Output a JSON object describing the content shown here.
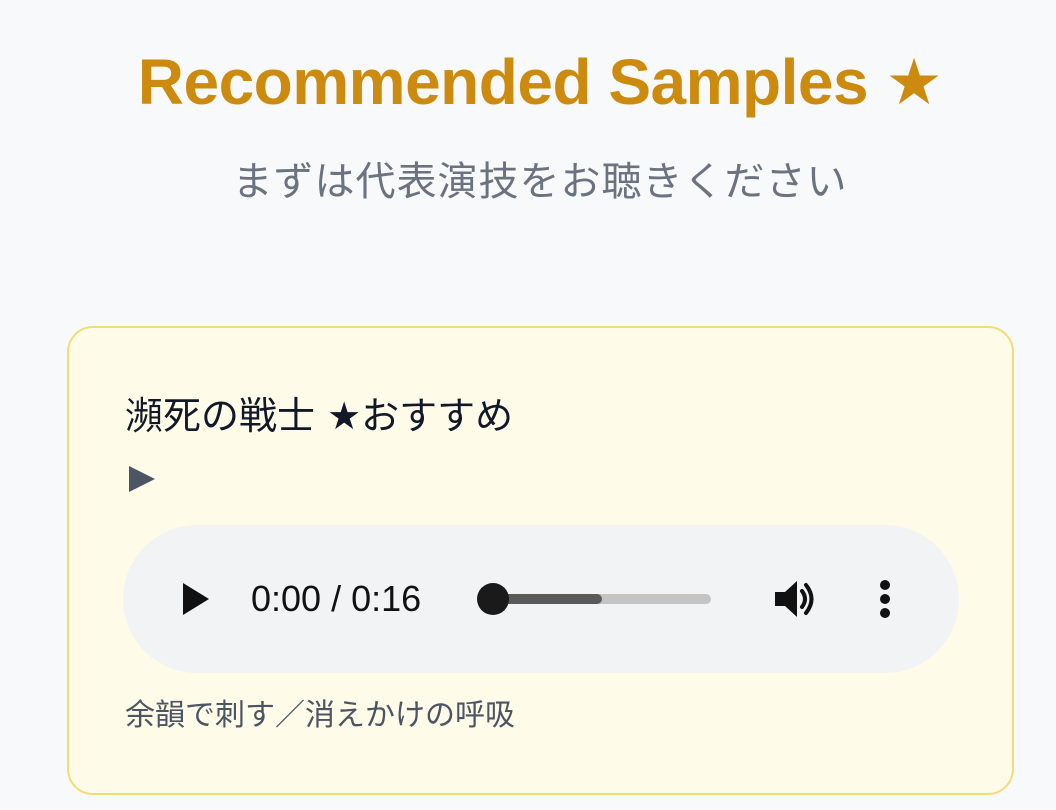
{
  "header": {
    "title": "Recommended Samples ★",
    "subtitle": "まずは代表演技をお聴きください"
  },
  "card": {
    "title": "瀕死の戦士 ★おすすめ",
    "player": {
      "time_display": "0:00 / 0:16",
      "buffered_fraction": 0.5,
      "played_fraction": 0.0
    },
    "caption": "余韻で刺す／消えかけの呼吸"
  },
  "icons": {
    "expand": "play-triangle-icon",
    "play": "play-icon",
    "volume": "volume-icon",
    "menu": "more-vert-icon"
  },
  "colors": {
    "title": "#cc8b0e",
    "subtitle": "#6b7280",
    "card_bg": "#fefbe8",
    "card_border": "#f3dc78",
    "player_bg": "#f1f3f4"
  }
}
